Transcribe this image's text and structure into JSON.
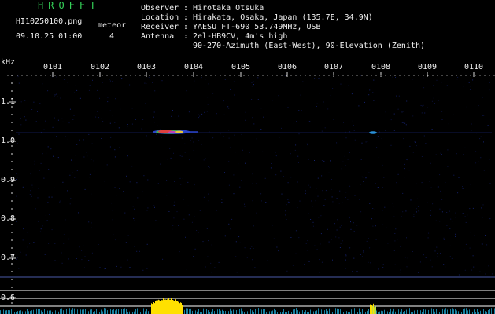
{
  "header": {
    "brand": "HROFFT",
    "filename": "HI10250100.png",
    "datetime": "09.10.25 01:00",
    "meteor_label": "meteor",
    "meteor_count": "4"
  },
  "info": {
    "observer_label": "Observer",
    "observer": "Hirotaka Otsuka",
    "location_label": "Location",
    "location": "Hirakata, Osaka, Japan (135.7E, 34.9N)",
    "receiver_label": "Receiver",
    "receiver": "YAESU FT-690 53.749MHz, USB",
    "antenna_label": "Antenna",
    "antenna_line1": "2el-HB9CV, 4m's high",
    "antenna_line2": "90-270-Azimuth (East-West), 90-Elevation (Zenith)"
  },
  "axis": {
    "unit": "kHz",
    "time_ticks": [
      "0101",
      "0102",
      "0103",
      "0104",
      "0105",
      "0106",
      "0107",
      "0108",
      "0109",
      "0110"
    ],
    "freq_ticks": [
      "1.1",
      "1.0",
      "0.9",
      "0.8",
      "0.7",
      "0.6"
    ]
  },
  "colors": {
    "background": "#000000",
    "text": "#f0f0f0",
    "brand": "#34d058",
    "baseline": "#ffffff",
    "level_bar": "#ffe000",
    "noise": "#1a2a8a"
  }
}
